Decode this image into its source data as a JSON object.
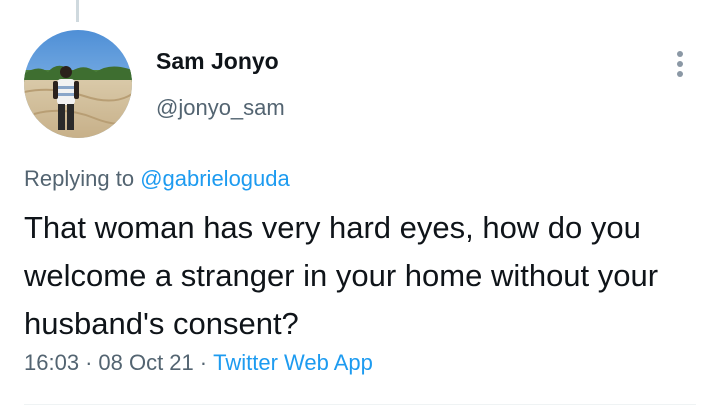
{
  "author": {
    "name": "Sam Jonyo",
    "handle": "@jonyo_sam"
  },
  "reply": {
    "prefix": "Replying to ",
    "target": "@gabrieloguda"
  },
  "tweet": {
    "text": "That woman has very hard eyes, how do you welcome a stranger in your home without your husband's consent?"
  },
  "meta": {
    "time": "16:03",
    "date": "08 Oct 21",
    "separator": "·",
    "source": "Twitter Web App"
  },
  "icons": {
    "more": "more-vertical-icon"
  },
  "colors": {
    "link": "#1d9bf0",
    "secondary_text": "#536471",
    "primary_text": "#0f1419"
  }
}
